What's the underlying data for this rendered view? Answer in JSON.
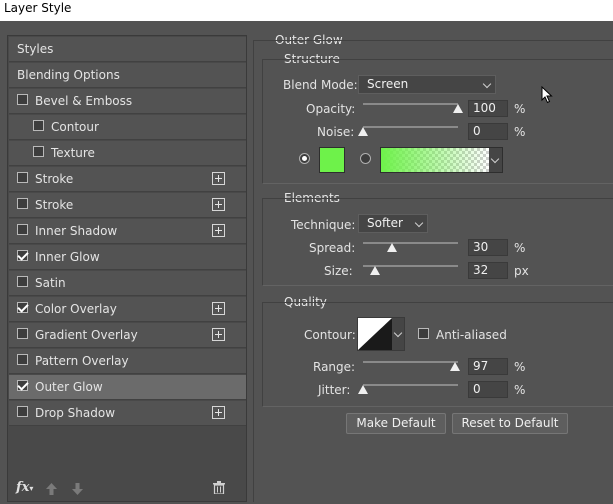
{
  "window": {
    "title": "Layer Style"
  },
  "left": {
    "items": [
      {
        "label": "Styles",
        "checkbox": false,
        "checked": false,
        "plus": false,
        "indent": 0
      },
      {
        "label": "Blending Options",
        "checkbox": false,
        "checked": false,
        "plus": false,
        "indent": 0
      },
      {
        "label": "Bevel & Emboss",
        "checkbox": true,
        "checked": false,
        "plus": false,
        "indent": 0
      },
      {
        "label": "Contour",
        "checkbox": true,
        "checked": false,
        "plus": false,
        "indent": 1
      },
      {
        "label": "Texture",
        "checkbox": true,
        "checked": false,
        "plus": false,
        "indent": 1
      },
      {
        "label": "Stroke",
        "checkbox": true,
        "checked": false,
        "plus": true,
        "indent": 0
      },
      {
        "label": "Stroke",
        "checkbox": true,
        "checked": false,
        "plus": true,
        "indent": 0
      },
      {
        "label": "Inner Shadow",
        "checkbox": true,
        "checked": false,
        "plus": true,
        "indent": 0
      },
      {
        "label": "Inner Glow",
        "checkbox": true,
        "checked": true,
        "plus": false,
        "indent": 0
      },
      {
        "label": "Satin",
        "checkbox": true,
        "checked": false,
        "plus": false,
        "indent": 0
      },
      {
        "label": "Color Overlay",
        "checkbox": true,
        "checked": true,
        "plus": true,
        "indent": 0
      },
      {
        "label": "Gradient Overlay",
        "checkbox": true,
        "checked": false,
        "plus": true,
        "indent": 0
      },
      {
        "label": "Pattern Overlay",
        "checkbox": true,
        "checked": false,
        "plus": false,
        "indent": 0
      },
      {
        "label": "Outer Glow",
        "checkbox": true,
        "checked": true,
        "plus": false,
        "indent": 0,
        "selected": true
      },
      {
        "label": "Drop Shadow",
        "checkbox": true,
        "checked": false,
        "plus": true,
        "indent": 0
      }
    ],
    "footer": {
      "fx_label": "fx"
    }
  },
  "panel": {
    "title": "Outer Glow",
    "structure": {
      "title": "Structure",
      "blend_mode_label": "Blend Mode:",
      "blend_mode_value": "Screen",
      "opacity_label": "Opacity:",
      "opacity_value": "100",
      "opacity_fraction": 1.0,
      "noise_label": "Noise:",
      "noise_value": "0",
      "noise_fraction": 0.0,
      "percent": "%",
      "glow_color": "#6ef24a"
    },
    "elements": {
      "title": "Elements",
      "technique_label": "Technique:",
      "technique_value": "Softer",
      "spread_label": "Spread:",
      "spread_value": "30",
      "spread_fraction": 0.3,
      "size_label": "Size:",
      "size_value": "32",
      "size_fraction": 0.13,
      "percent": "%",
      "px": "px"
    },
    "quality": {
      "title": "Quality",
      "contour_label": "Contour:",
      "anti_aliased_label": "Anti-aliased",
      "range_label": "Range:",
      "range_value": "97",
      "range_fraction": 0.97,
      "jitter_label": "Jitter:",
      "jitter_value": "0",
      "jitter_fraction": 0.0,
      "percent": "%"
    },
    "buttons": {
      "make_default": "Make Default",
      "reset_default": "Reset to Default"
    }
  }
}
